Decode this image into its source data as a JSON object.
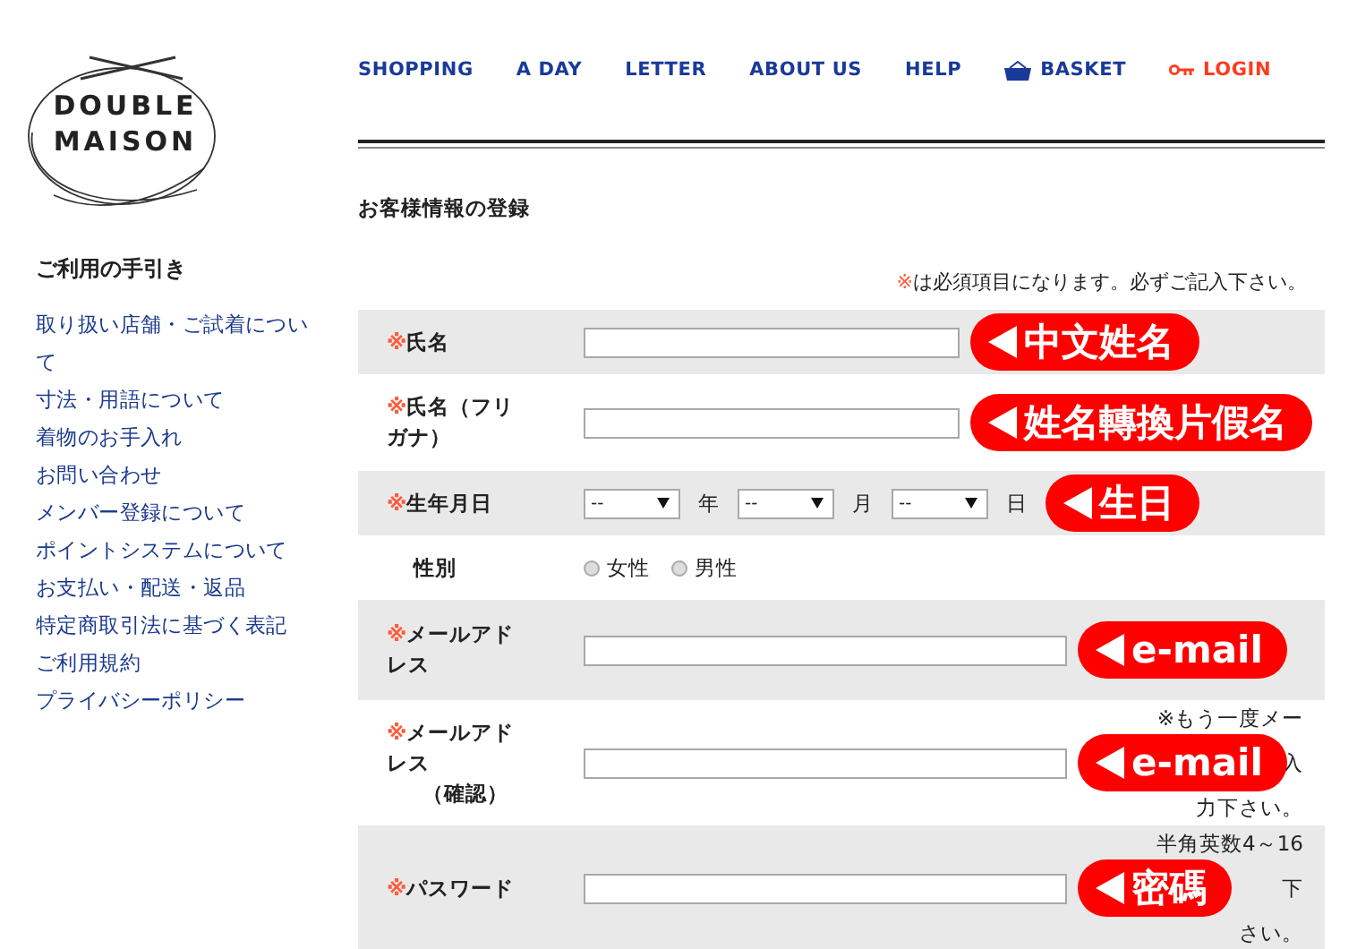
{
  "logo": {
    "line_1": "DOUBLE",
    "line_2": "MAISON"
  },
  "nav": [
    {
      "label": "SHOPPING",
      "kind": "plain"
    },
    {
      "label": "A DAY",
      "kind": "plain"
    },
    {
      "label": "LETTER",
      "kind": "plain"
    },
    {
      "label": "ABOUT US",
      "kind": "plain"
    },
    {
      "label": "HELP",
      "kind": "plain"
    },
    {
      "label": "BASKET",
      "kind": "basket"
    },
    {
      "label": "LOGIN",
      "kind": "login"
    }
  ],
  "sidebar": {
    "title": "ご利用の手引き",
    "items": [
      "取り扱い店舗・ご試着について",
      "寸法・用語について",
      "着物のお手入れ",
      "お問い合わせ",
      "メンバー登録について",
      "ポイントシステムについて",
      "お支払い・配送・返品",
      "特定商取引法に基づく表記",
      "ご利用規約",
      "プライバシーポリシー"
    ]
  },
  "page_title": "お客様情報の登録",
  "required_note": {
    "mark": "※",
    "text": "は必須項目になります。必ずご記入下さい。"
  },
  "fields": [
    {
      "kind": "text",
      "mark": "※",
      "label": "氏名",
      "badge": "中文姓名"
    },
    {
      "kind": "text",
      "mark": "※",
      "label": "氏名（フリガナ）",
      "badge": "姓名轉換片假名"
    },
    {
      "kind": "date",
      "mark": "※",
      "label": "生年月日",
      "selects": [
        {
          "value": "--",
          "unit": "年"
        },
        {
          "value": "--",
          "unit": "月"
        },
        {
          "value": "--",
          "unit": "日"
        }
      ],
      "badge": "生日"
    },
    {
      "kind": "radio",
      "label": "性別",
      "options": [
        {
          "label": "女性",
          "selected": false
        },
        {
          "label": "男性",
          "selected": false
        }
      ]
    },
    {
      "kind": "wide",
      "mark": "※",
      "label": "メールアドレス",
      "badge": "e-mail"
    },
    {
      "kind": "wide",
      "mark": "※",
      "label": "メールアドレス",
      "sub": "（確認）",
      "badge": "e-mail",
      "note": [
        "※もう一度メー",
        "入",
        "力下さい。"
      ]
    },
    {
      "kind": "wide",
      "mark": "※",
      "label": "パスワード",
      "badge": "密碼",
      "note": [
        "半角英数4～16",
        "下",
        "さい。"
      ]
    }
  ]
}
